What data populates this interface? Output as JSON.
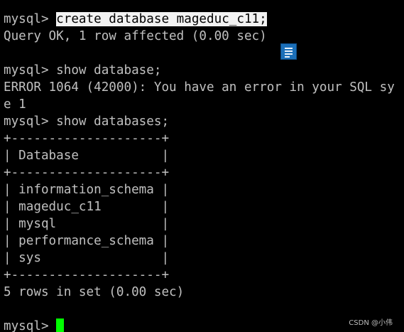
{
  "terminal": {
    "lines": [
      {
        "prompt": "mysql> ",
        "text": "create database mageduc_c11;"
      },
      {
        "text": "Query OK, 1 row affected (0.00 sec)"
      },
      {
        "text": ""
      },
      {
        "prompt": "mysql> ",
        "text": "show database;"
      },
      {
        "text": "ERROR 1064 (42000): You have an error in your SQL sy"
      },
      {
        "text": "e 1"
      },
      {
        "prompt": "mysql> ",
        "text": "show databases;"
      },
      {
        "text": "+--------------------+"
      },
      {
        "text": "| Database           |"
      },
      {
        "text": "+--------------------+"
      },
      {
        "text": "| information_schema |"
      },
      {
        "text": "| mageduc_c11        |"
      },
      {
        "text": "| mysql              |"
      },
      {
        "text": "| performance_schema |"
      },
      {
        "text": "| sys                |"
      },
      {
        "text": "+--------------------+"
      },
      {
        "text": "5 rows in set (0.00 sec)"
      },
      {
        "text": ""
      },
      {
        "prompt": "mysql> ",
        "text": ""
      }
    ]
  },
  "icons": {
    "floating_icon": "document-icon"
  },
  "watermark": "CSDN @小伟",
  "colors": {
    "background": "#000000",
    "text": "#c0c0c0",
    "selection_bg": "#f2f2f2",
    "cursor": "#00ff00",
    "icon": "#1b6fb8"
  }
}
